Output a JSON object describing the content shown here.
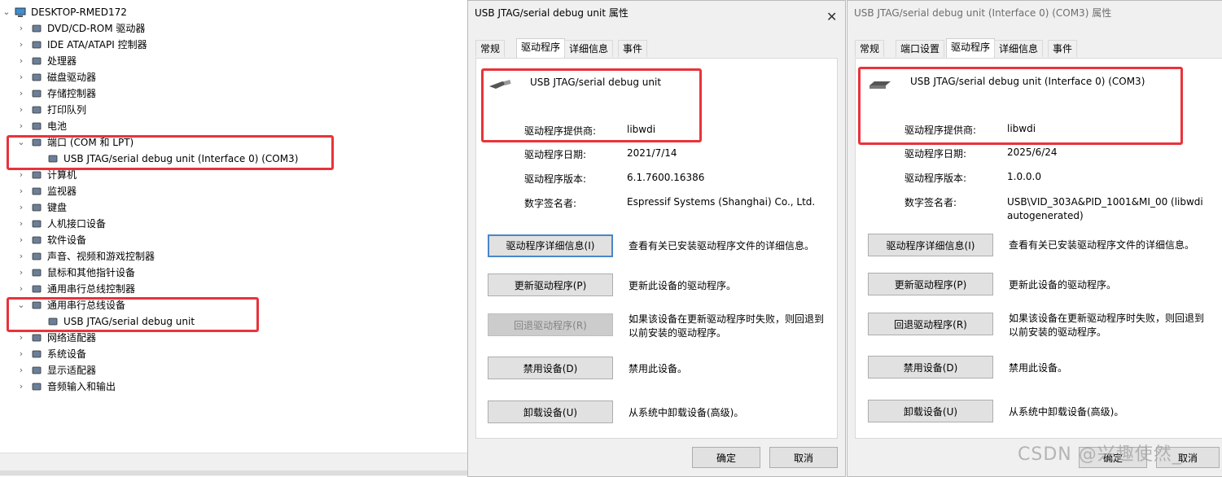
{
  "device_manager": {
    "root": "DESKTOP-RMED172",
    "items": [
      {
        "label": "DVD/CD-ROM 驱动器",
        "icon": "dvd-drive-icon",
        "expanded": false
      },
      {
        "label": "IDE ATA/ATAPI 控制器",
        "icon": "ide-controller-icon",
        "expanded": false
      },
      {
        "label": "处理器",
        "icon": "processor-icon",
        "expanded": false
      },
      {
        "label": "磁盘驱动器",
        "icon": "disk-drive-icon",
        "expanded": false
      },
      {
        "label": "存储控制器",
        "icon": "storage-controller-icon",
        "expanded": false
      },
      {
        "label": "打印队列",
        "icon": "printer-icon",
        "expanded": false
      },
      {
        "label": "电池",
        "icon": "battery-icon",
        "expanded": false
      },
      {
        "label": "端口 (COM 和 LPT)",
        "icon": "port-icon",
        "expanded": true
      },
      {
        "label": "USB JTAG/serial debug unit (Interface 0) (COM3)",
        "icon": "port-device-icon",
        "child": true
      },
      {
        "label": "计算机",
        "icon": "computer-icon",
        "expanded": false
      },
      {
        "label": "监视器",
        "icon": "monitor-icon",
        "expanded": false
      },
      {
        "label": "键盘",
        "icon": "keyboard-icon",
        "expanded": false
      },
      {
        "label": "人机接口设备",
        "icon": "hid-icon",
        "expanded": false
      },
      {
        "label": "软件设备",
        "icon": "software-device-icon",
        "expanded": false
      },
      {
        "label": "声音、视频和游戏控制器",
        "icon": "sound-icon",
        "expanded": false
      },
      {
        "label": "鼠标和其他指针设备",
        "icon": "mouse-icon",
        "expanded": false
      },
      {
        "label": "通用串行总线控制器",
        "icon": "usb-controller-icon",
        "expanded": false
      },
      {
        "label": "通用串行总线设备",
        "icon": "usb-device-icon",
        "expanded": true
      },
      {
        "label": "USB JTAG/serial debug unit",
        "icon": "usb-plug-icon",
        "child": true
      },
      {
        "label": "网络适配器",
        "icon": "network-adapter-icon",
        "expanded": false
      },
      {
        "label": "系统设备",
        "icon": "system-device-icon",
        "expanded": false
      },
      {
        "label": "显示适配器",
        "icon": "display-adapter-icon",
        "expanded": false
      },
      {
        "label": "音频输入和输出",
        "icon": "audio-io-icon",
        "expanded": false
      }
    ]
  },
  "dialog1": {
    "title": "USB JTAG/serial debug unit 属性",
    "tabs": [
      "常规",
      "驱动程序",
      "详细信息",
      "事件"
    ],
    "active_tab": "驱动程序",
    "device_name": "USB JTAG/serial debug unit",
    "provider_label": "驱动程序提供商:",
    "provider": "libwdi",
    "date_label": "驱动程序日期:",
    "date": "2021/7/14",
    "version_label": "驱动程序版本:",
    "version": "6.1.7600.16386",
    "signer_label": "数字签名者:",
    "signer": "Espressif Systems (Shanghai) Co., Ltd.",
    "buttons": [
      {
        "label": "驱动程序详细信息(I)",
        "desc": "查看有关已安装驱动程序文件的详细信息。"
      },
      {
        "label": "更新驱动程序(P)",
        "desc": "更新此设备的驱动程序。"
      },
      {
        "label": "回退驱动程序(R)",
        "desc": "如果该设备在更新驱动程序时失败，则回退到以前安装的驱动程序。"
      },
      {
        "label": "禁用设备(D)",
        "desc": "禁用此设备。"
      },
      {
        "label": "卸载设备(U)",
        "desc": "从系统中卸载设备(高级)。"
      }
    ],
    "ok": "确定",
    "cancel": "取消"
  },
  "dialog2": {
    "title": "USB JTAG/serial debug unit (Interface 0) (COM3) 属性",
    "tabs": [
      "常规",
      "端口设置",
      "驱动程序",
      "详细信息",
      "事件"
    ],
    "active_tab": "驱动程序",
    "device_name": "USB JTAG/serial debug unit (Interface 0) (COM3)",
    "provider_label": "驱动程序提供商:",
    "provider": "libwdi",
    "date_label": "驱动程序日期:",
    "date": "2025/6/24",
    "version_label": "驱动程序版本:",
    "version": "1.0.0.0",
    "signer_label": "数字签名者:",
    "signer": "USB\\VID_303A&PID_1001&MI_00 (libwdi autogenerated)",
    "buttons": [
      {
        "label": "驱动程序详细信息(I)",
        "desc": "查看有关已安装驱动程序文件的详细信息。"
      },
      {
        "label": "更新驱动程序(P)",
        "desc": "更新此设备的驱动程序。"
      },
      {
        "label": "回退驱动程序(R)",
        "desc": "如果该设备在更新驱动程序时失败，则回退到以前安装的驱动程序。"
      },
      {
        "label": "禁用设备(D)",
        "desc": "禁用此设备。"
      },
      {
        "label": "卸载设备(U)",
        "desc": "从系统中卸载设备(高级)。"
      }
    ],
    "ok": "确定",
    "cancel": "取消"
  },
  "watermark": "CSDN @兴趣使然_",
  "colors": {
    "highlight": "#e8333b",
    "focus": "#4a86c8"
  }
}
